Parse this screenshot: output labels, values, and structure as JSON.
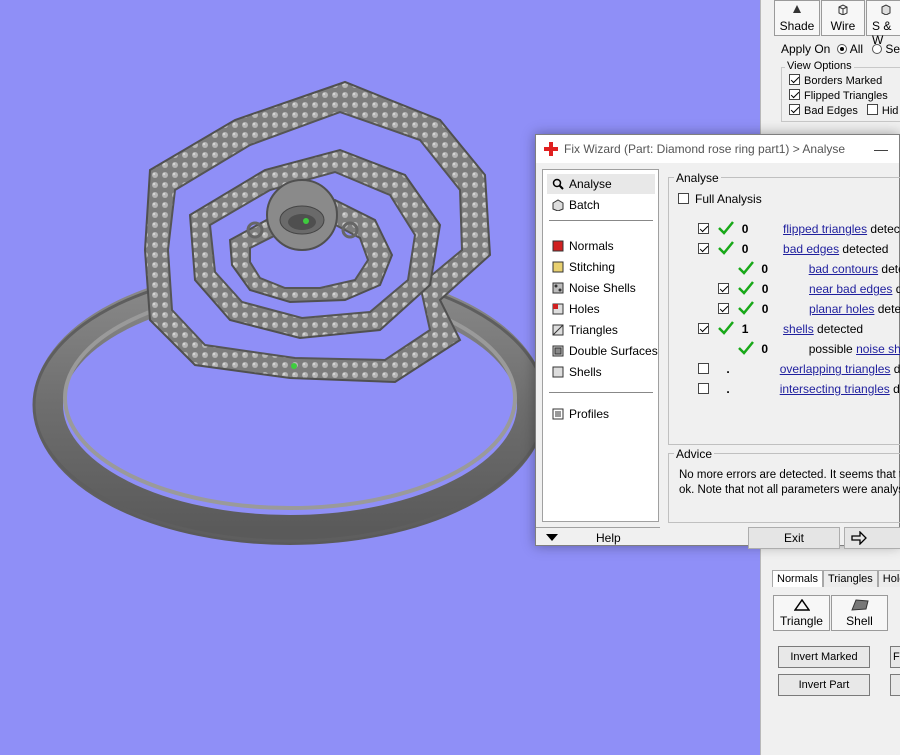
{
  "toolbar": {
    "shade": "Shade",
    "wire": "Wire",
    "sw": "S & W"
  },
  "apply": {
    "label": "Apply On",
    "all": "All",
    "selected": "Sele"
  },
  "view_options": {
    "title": "View Options",
    "borders_marked": "Borders Marked",
    "flipped_triangles": "Flipped Triangles",
    "bad_edges": "Bad Edges",
    "hide": "Hid"
  },
  "dialog": {
    "title": "Fix Wizard (Part: Diamond rose ring part1) > Analyse",
    "minimize": "—",
    "nav": {
      "analyse": "Analyse",
      "batch": "Batch",
      "normals": "Normals",
      "stitching": "Stitching",
      "noise_shells": "Noise Shells",
      "holes": "Holes",
      "triangles": "Triangles",
      "double_surfaces": "Double Surfaces",
      "shells": "Shells",
      "profiles": "Profiles"
    },
    "help": "Help",
    "analyse": {
      "title": "Analyse",
      "full_analysis": "Full Analysis",
      "rows": [
        {
          "count": "0",
          "link": "flipped triangles",
          "suffix": " detected"
        },
        {
          "count": "0",
          "link": "bad edges",
          "suffix": " detected"
        },
        {
          "count": "0",
          "link": "bad contours",
          "suffix": " detecte"
        },
        {
          "count": "0",
          "link": "near bad edges",
          "suffix": " dete"
        },
        {
          "count": "0",
          "link": "planar holes",
          "suffix": " detecte"
        },
        {
          "count": "1",
          "link": "shells",
          "suffix": " detected"
        },
        {
          "count": "0",
          "prefix": "possible ",
          "link": "noise shells",
          "suffix": " "
        },
        {
          "count": ".",
          "link": "overlapping triangles",
          "suffix": " det"
        },
        {
          "count": ".",
          "link": "intersecting triangles",
          "suffix": " det"
        }
      ]
    },
    "advice": {
      "title": "Advice",
      "line1": "No more errors are detected. It seems that th",
      "line2": "ok. Note that not all parameters were analyse"
    },
    "exit": "Exit"
  },
  "bottom_panel": {
    "tabs": [
      "Normals",
      "Triangles",
      "Hole"
    ],
    "triangle": "Triangle",
    "shell": "Shell",
    "invert_marked": "Invert Marked",
    "invert_part": "Invert Part",
    "f": "F"
  }
}
